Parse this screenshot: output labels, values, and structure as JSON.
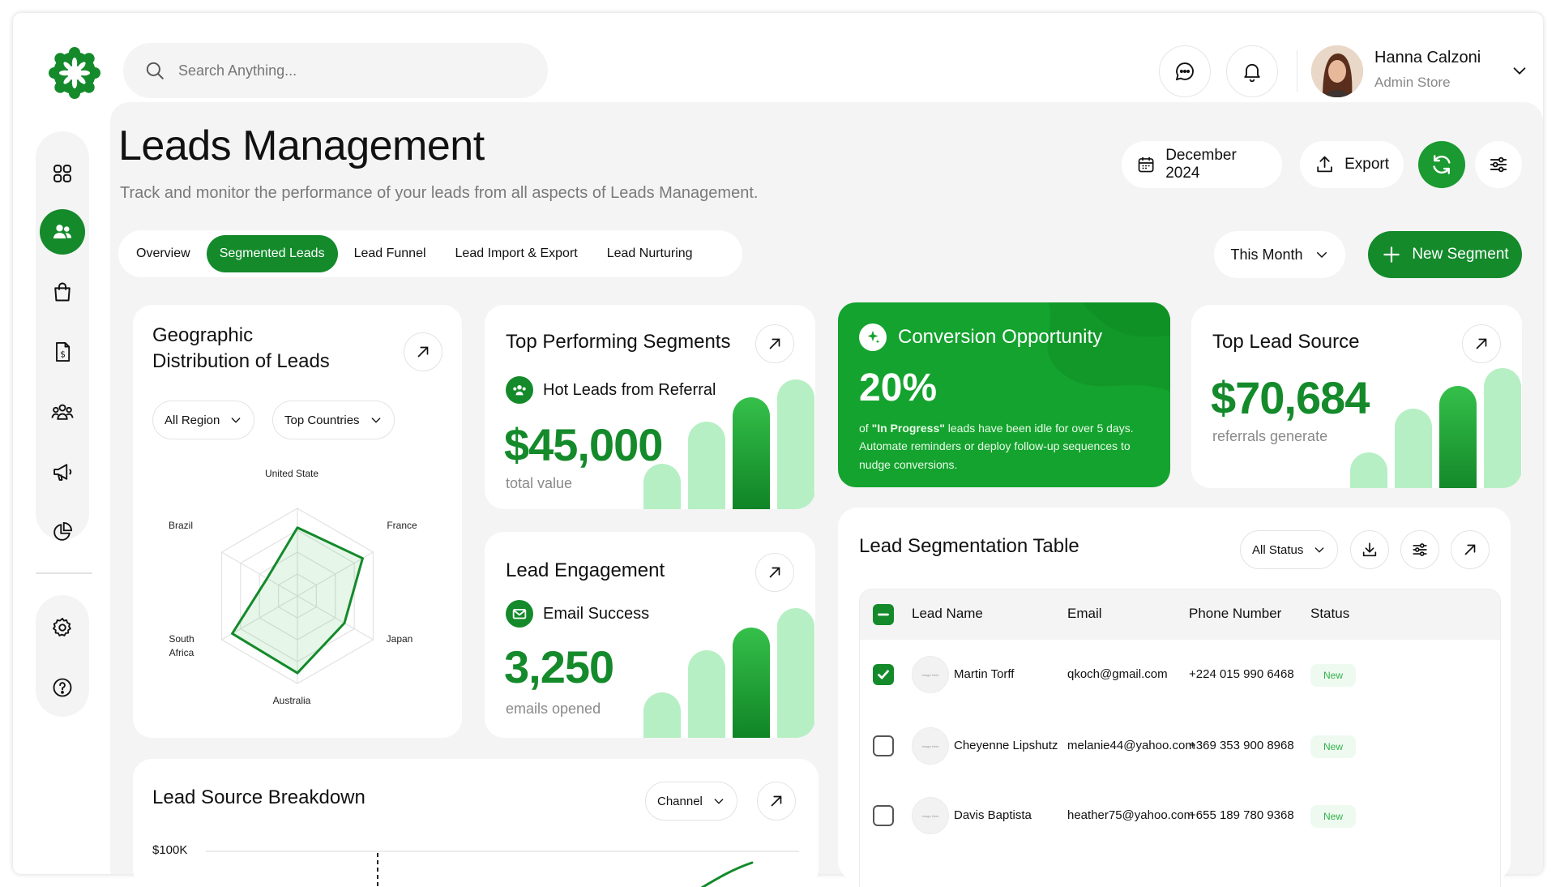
{
  "search": {
    "placeholder": "Search Anything..."
  },
  "user": {
    "name": "Hanna Calzoni",
    "role": "Admin Store"
  },
  "header": {
    "title": "Leads Management",
    "subtitle": "Track and monitor the performance of your leads from all aspects of Leads Management.",
    "date_label": "December 2024",
    "export_label": "Export"
  },
  "tabs": [
    {
      "label": "Overview",
      "active": false
    },
    {
      "label": "Segmented Leads",
      "active": true
    },
    {
      "label": "Lead Funnel",
      "active": false
    },
    {
      "label": "Lead Import & Export",
      "active": false
    },
    {
      "label": "Lead Nurturing",
      "active": false
    }
  ],
  "filters": {
    "period": "This Month",
    "new_segment": "New Segment"
  },
  "geo": {
    "title_line1": "Geographic",
    "title_line2": "Distribution of Leads",
    "region_filter": "All Region",
    "country_filter": "Top Countries",
    "labels": [
      "United State",
      "France",
      "Japan",
      "Australia",
      "South Africa",
      "Brazil"
    ],
    "values": [
      0.78,
      0.86,
      0.62,
      0.88,
      0.86,
      0.4
    ]
  },
  "top_segments": {
    "title": "Top Performing Segments",
    "segment": "Hot Leads from Referral",
    "value": "$45,000",
    "caption": "total value"
  },
  "conversion": {
    "title": "Conversion Opportunity",
    "percent": "20%",
    "text_prefix": "of ",
    "text_highlight": "\"In Progress\"",
    "text_rest": " leads have been idle for over 5 days. Automate reminders or deploy follow-up sequences to nudge conversions."
  },
  "top_source": {
    "title": "Top Lead Source",
    "value": "$70,684",
    "caption": "referrals generate"
  },
  "engagement": {
    "title": "Lead Engagement",
    "metric": "Email Success",
    "value": "3,250",
    "caption": "emails opened"
  },
  "table": {
    "title": "Lead Segmentation Table",
    "status_filter": "All Status",
    "columns": [
      "Lead Name",
      "Email",
      "Phone Number",
      "Status"
    ],
    "avatar_placeholder": "Image Here",
    "rows": [
      {
        "name": "Martin Torff",
        "email": "qkoch@gmail.com",
        "phone": "+224 015 990 6468",
        "status": "New",
        "checked": true
      },
      {
        "name": "Cheyenne Lipshutz",
        "email": "melanie44@yahoo.com",
        "phone": "+369 353 900 8968",
        "status": "New",
        "checked": false
      },
      {
        "name": "Davis Baptista",
        "email": "heather75@yahoo.com",
        "phone": "+655 189 780 9368",
        "status": "New",
        "checked": false
      }
    ]
  },
  "breakdown": {
    "title": "Lead Source Breakdown",
    "channel_filter": "Channel",
    "y_tick": "$100K"
  },
  "colors": {
    "primary": "#148a2b",
    "bright": "#14a32e",
    "light": "#b6efc4",
    "bg": "#f4f4f4"
  },
  "icons": {
    "sidebar": [
      "grid-icon",
      "users-icon",
      "shopping-bag-icon",
      "invoice-icon",
      "team-icon",
      "megaphone-icon",
      "pie-chart-icon"
    ],
    "sidebar_bottom": [
      "settings-icon",
      "help-icon"
    ]
  }
}
